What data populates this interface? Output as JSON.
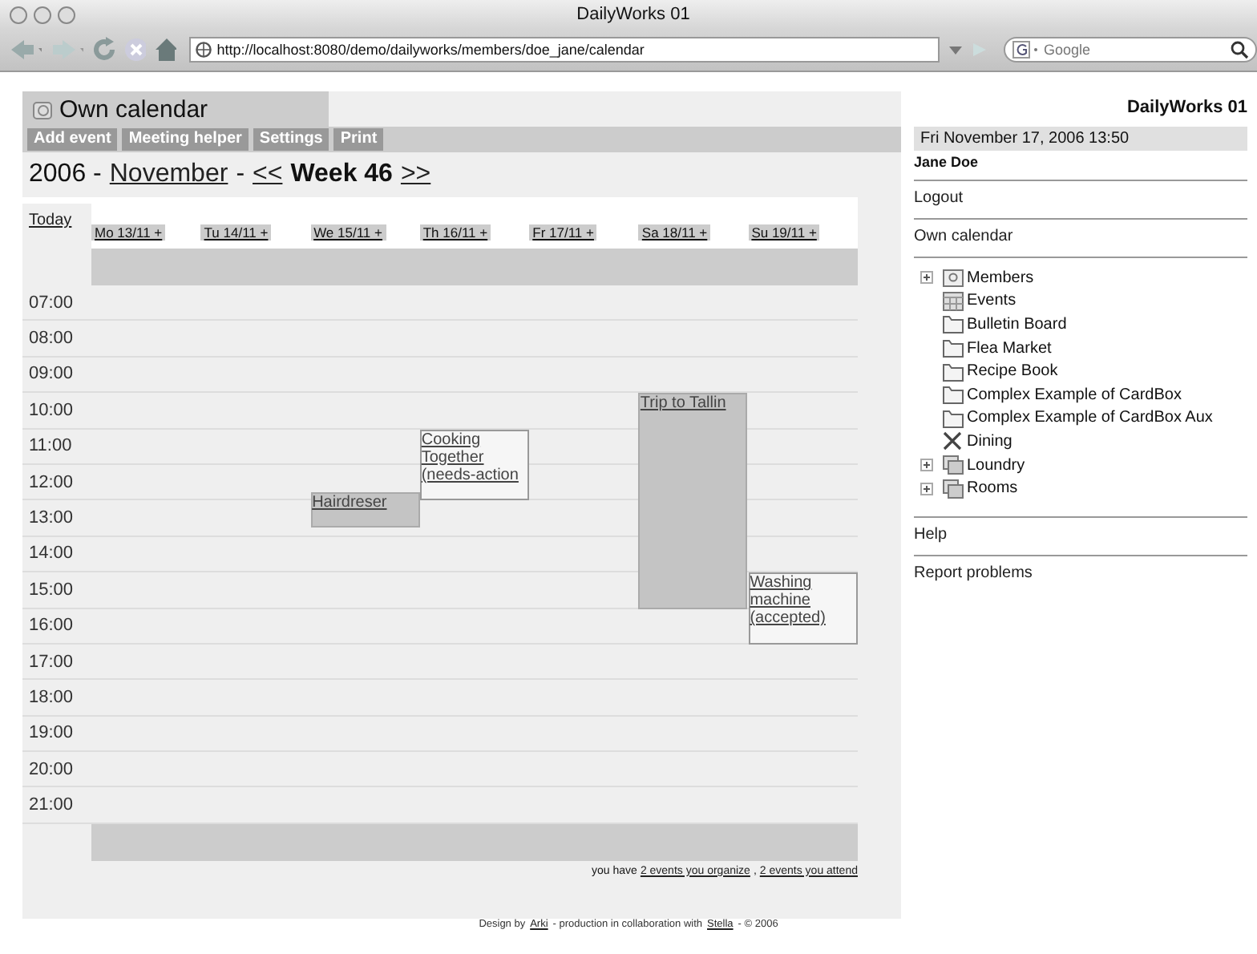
{
  "window": {
    "title": "DailyWorks 01"
  },
  "toolbar": {
    "url": "http://localhost:8080/demo/dailyworks/members/doe_jane/calendar",
    "search": {
      "placeholder": "Google"
    }
  },
  "page": {
    "header_title": "Own calendar",
    "actions": [
      "Add event",
      "Meeting helper",
      "Settings",
      "Print"
    ],
    "heading": {
      "year": "2006 -",
      "month": "November",
      "separator": "-",
      "prev": "<<",
      "week": "Week 46",
      "next": ">>"
    },
    "today": "Today",
    "days": [
      {
        "label": "Mo 13/11 +"
      },
      {
        "label": "Tu 14/11 +"
      },
      {
        "label": "We 15/11 +",
        "events": [
          {
            "title": "Hairdreser",
            "kind": "own"
          }
        ]
      },
      {
        "label": "Th 16/11 +",
        "events": [
          {
            "title": "Cooking Together (needs-action",
            "kind": "invitation"
          }
        ]
      },
      {
        "label": "Fr 17/11 +"
      },
      {
        "label": "Sa 18/11 +",
        "events": [
          {
            "title": "Trip to Tallin",
            "kind": "own"
          }
        ]
      },
      {
        "label": "Su 19/11 +",
        "events": [
          {
            "title": "Washing machine (accepted)",
            "kind": "invitation"
          }
        ]
      }
    ],
    "hours": [
      "07:00",
      "08:00",
      "09:00",
      "10:00",
      "11:00",
      "12:00",
      "13:00",
      "14:00",
      "15:00",
      "16:00",
      "17:00",
      "18:00",
      "19:00",
      "20:00",
      "21:00"
    ],
    "summary": {
      "prefix": "you have",
      "organize": "2 events you organize",
      "separator": ",",
      "attend": "2 events you attend"
    }
  },
  "sidebar": {
    "site_title": "DailyWorks 01",
    "date": "Fri November 17, 2006 13:50",
    "user": "Jane Doe",
    "logout": "Logout",
    "own_calendar": "Own calendar",
    "tree": [
      {
        "label": "Members",
        "kind": "members",
        "expanded": false
      },
      {
        "label": "Events",
        "kind": "calendar"
      },
      {
        "label": "Bulletin Board",
        "kind": "board"
      },
      {
        "label": "Flea Market",
        "kind": "board"
      },
      {
        "label": "Recipe Book",
        "kind": "board"
      },
      {
        "label": "Complex Example of CardBox",
        "kind": "board"
      },
      {
        "label": "Complex Example of CardBox Aux",
        "kind": "board"
      },
      {
        "label": "Dining",
        "kind": "dining"
      },
      {
        "label": "Loundry",
        "kind": "stack",
        "expanded": false
      },
      {
        "label": "Rooms",
        "kind": "stack",
        "expanded": false
      }
    ],
    "help": "Help",
    "report": "Report problems"
  },
  "footer": {
    "parts": [
      {
        "text": "Design by",
        "link": false
      },
      {
        "text": "Arki",
        "link": true
      },
      {
        "text": "- production in collaboration with",
        "link": false
      },
      {
        "text": "Stella",
        "link": true
      },
      {
        "text": "- © 2006",
        "link": false
      }
    ]
  }
}
